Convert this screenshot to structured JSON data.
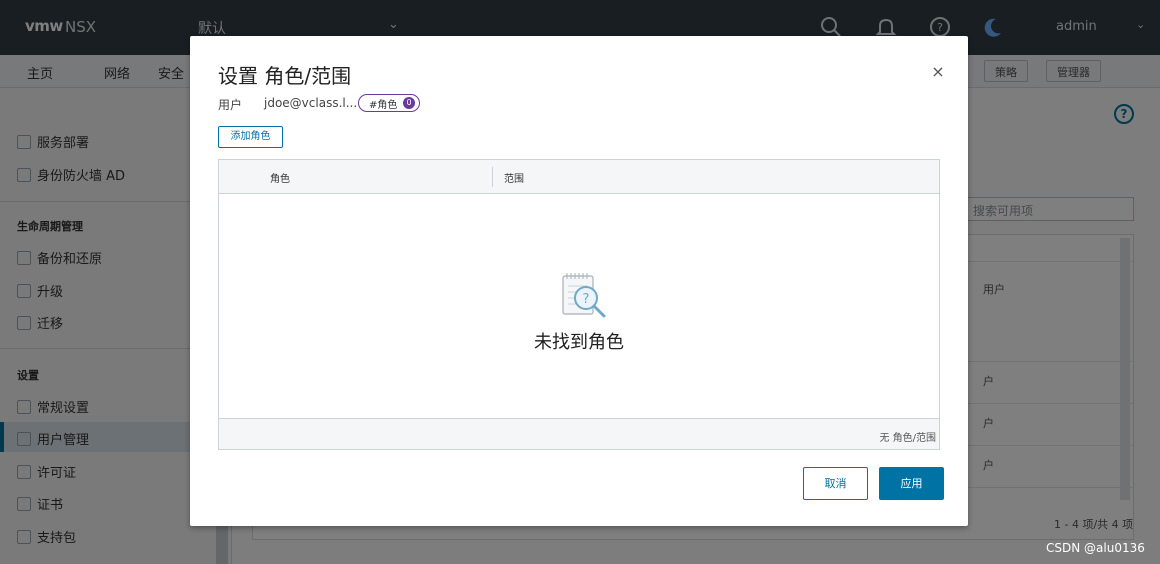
{
  "app": {
    "logo": "vmw",
    "product": "NSX",
    "context": "默认",
    "user": "admin"
  },
  "nav": {
    "items": [
      "主页",
      "网络",
      "安全"
    ],
    "buttons": [
      "策略",
      "管理器"
    ]
  },
  "sidebar": {
    "items_top": [
      "服务部署",
      "身份防火墙 AD"
    ],
    "lifecycle_heading": "生命周期管理",
    "lifecycle_items": [
      "备份和还原",
      "升级",
      "迁移"
    ],
    "settings_heading": "设置",
    "settings_items": [
      "常规设置",
      "用户管理",
      "许可证",
      "证书",
      "支持包"
    ]
  },
  "background": {
    "search_placeholder": "搜索可用项",
    "row_cells": [
      "用户",
      "户",
      "户",
      "户"
    ],
    "count": "1 - 4 项/共 4 项"
  },
  "modal": {
    "title": "设置 角色/范围",
    "user_label": "用户",
    "user_value": "jdoe@vclass.l...",
    "role_badge": "#角色",
    "role_count": "0",
    "add_role": "添加角色",
    "columns": [
      "角色",
      "范围"
    ],
    "empty_text": "未找到角色",
    "footer_info": "无 角色/范围",
    "cancel": "取消",
    "apply": "应用"
  },
  "watermark": "CSDN @alu0136",
  "colors": {
    "primary": "#0072a3",
    "badge": "#6a3aa0",
    "header_bg": "#313c45"
  }
}
